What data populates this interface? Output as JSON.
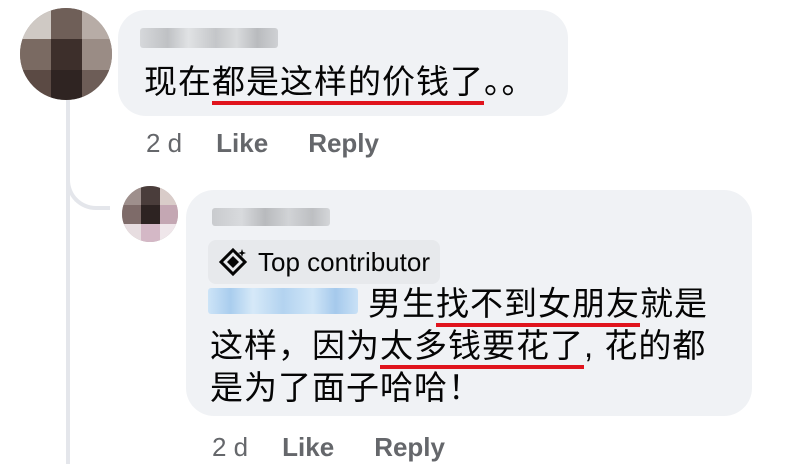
{
  "comments": [
    {
      "text_before": "现在",
      "text_highlight": "都是这样的价钱了",
      "text_after": "。。",
      "time": "2 d",
      "like_label": "Like",
      "reply_label": "Reply"
    },
    {
      "badge_label": "Top contributor",
      "badge_icon": "top-contributor-icon",
      "line1_before": "男生",
      "line1_highlight": "找不到女朋友",
      "line1_after": "就是",
      "line2_before": "这样，因为",
      "line2_highlight": "太多钱要花了",
      "line2_after": ", 花的都",
      "line3": "是为了面子哈哈！",
      "time": "2 d",
      "like_label": "Like",
      "reply_label": "Reply"
    }
  ],
  "colors": {
    "bubble": "#f0f2f5",
    "highlight_underline": "#e0141d",
    "meta_text": "#65676b",
    "badge_bg": "#e7e9ec"
  }
}
